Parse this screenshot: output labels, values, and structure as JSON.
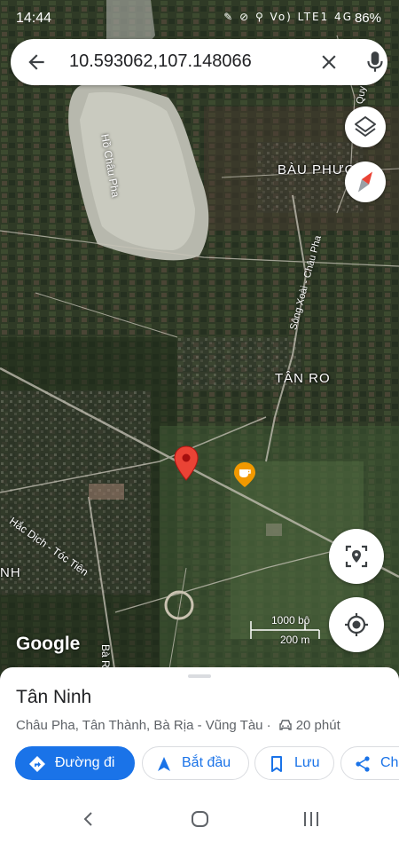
{
  "status": {
    "time": "14:44",
    "icons": "✎ ⊘ ⚲ Vo) LTE1 4G",
    "battery": "86%"
  },
  "search": {
    "query": "10.593062,107.148066"
  },
  "map": {
    "labels": {
      "lake": "Hồ Châu Pha",
      "bau_phuoc": "BÀU PHƯƠ",
      "tan_ro": "TÂN RO",
      "song_xoai": "Sông Xoài - Châu Pha",
      "hac_dich": "Hắc Dịch - Tóc Tiên",
      "ba_r": "Bà R",
      "nh": "NH",
      "road_top": "Quy Xoài"
    },
    "scale": {
      "top": "1000 bộ",
      "bottom": "200 m"
    },
    "brand": "Google"
  },
  "place": {
    "title": "Tân Ninh",
    "address": "Châu Pha, Tân Thành, Bà Rịa - Vũng Tàu ·",
    "travel_time": "20 phút"
  },
  "actions": {
    "directions": "Đường đi",
    "start": "Bắt đầu",
    "save": "Lưu",
    "share": "Chia sẻ"
  },
  "colors": {
    "accent": "#1a73e8",
    "pin": "#ea4335"
  }
}
